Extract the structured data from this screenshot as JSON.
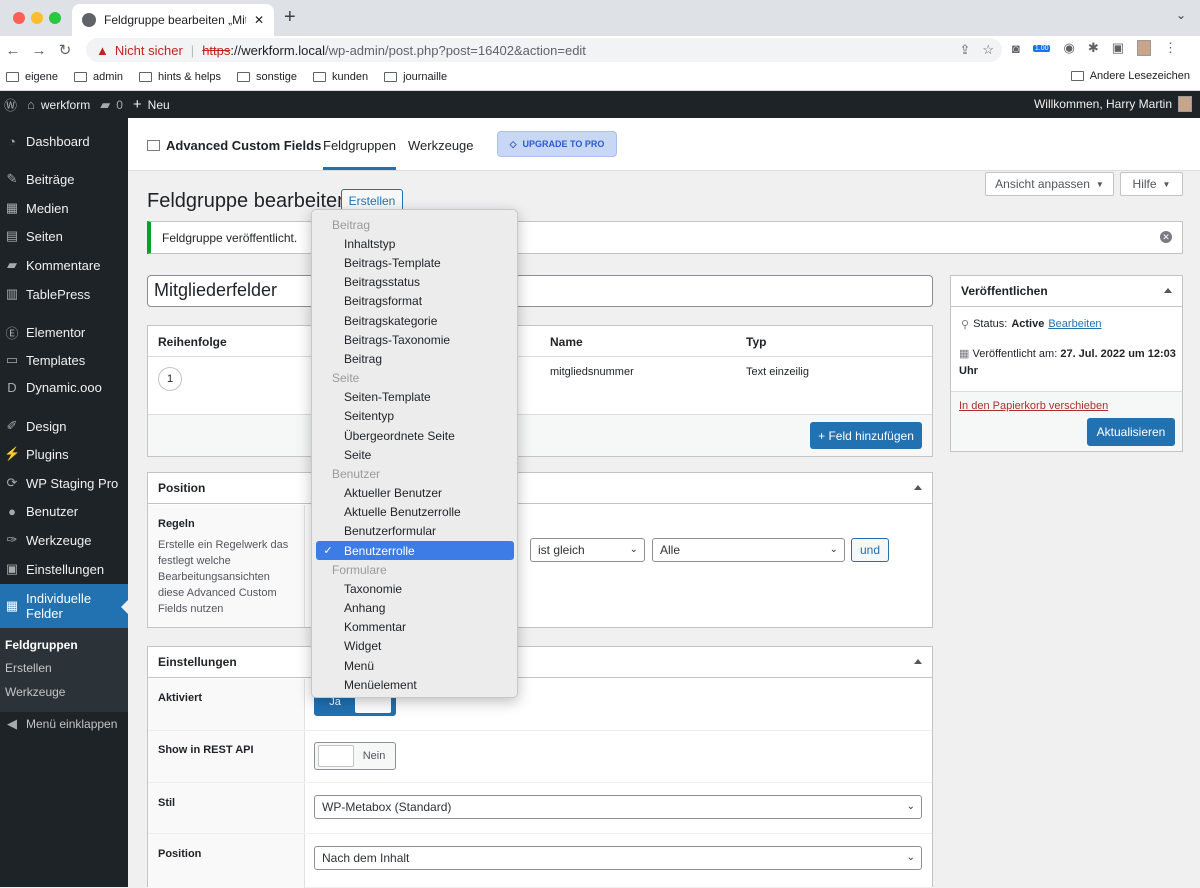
{
  "browser": {
    "tab_title": "Feldgruppe bearbeiten „Mitglie…",
    "security_text": "Nicht sicher",
    "url_scheme": "https",
    "url_host": "://werkform.local",
    "url_path": "/wp-admin/post.php?post=16402&action=edit",
    "ext_badge": "1.00",
    "bookmarks": [
      "eigene",
      "admin",
      "hints & helps",
      "sonstige",
      "kunden",
      "journaille"
    ],
    "other_bookmarks": "Andere Lesezeichen"
  },
  "adminbar": {
    "site_name": "werkform",
    "comments_count": "0",
    "new_label": "Neu",
    "greeting": "Willkommen, Harry Martin"
  },
  "sidebar": {
    "items": [
      "Dashboard",
      "Beiträge",
      "Medien",
      "Seiten",
      "Kommentare",
      "TablePress",
      "Elementor",
      "Templates",
      "Dynamic.ooo",
      "Design",
      "Plugins",
      "WP Staging Pro",
      "Benutzer",
      "Werkzeuge",
      "Einstellungen"
    ],
    "active_label": "Individuelle Felder",
    "submenu": [
      "Feldgruppen",
      "Erstellen",
      "Werkzeuge"
    ],
    "collapse_label": "Menü einklappen"
  },
  "acf": {
    "logo_text": "Advanced Custom Fields",
    "tabs": [
      "Feldgruppen",
      "Werkzeuge"
    ],
    "upgrade_label": "UPGRADE TO PRO"
  },
  "screen": {
    "options_label": "Ansicht anpassen",
    "help_label": "Hilfe"
  },
  "page": {
    "title": "Feldgruppe bearbeiten",
    "add_new_label": "Erstellen",
    "notice": "Feldgruppe veröffentlicht.",
    "group_title": "Mitgliederfelder"
  },
  "fields_table": {
    "headers": [
      "Reihenfolge",
      "Name",
      "Typ"
    ],
    "row": {
      "order": "1",
      "name": "mitgliedsnummer",
      "type": "Text einzeilig"
    },
    "add_field_label": "+ Feld hinzufügen"
  },
  "location_box": {
    "title": "Position",
    "rules_label": "Regeln",
    "rules_desc": "Erstelle ein Regelwerk das festlegt welche Bearbeitungsansichten diese Advanced Custom Fields nutzen",
    "operator": "ist gleich",
    "value": "Alle",
    "and_label": "und"
  },
  "settings_box": {
    "title": "Einstellungen",
    "active_label": "Aktiviert",
    "active_value": "Ja",
    "rest_label": "Show in REST API",
    "rest_value": "Nein",
    "style_label": "Stil",
    "style_value": "WP-Metabox (Standard)",
    "position_label": "Position",
    "position_value": "Nach dem Inhalt"
  },
  "publish_box": {
    "title": "Veröffentlichen",
    "status_prefix": "Status:",
    "status_value": "Active",
    "edit_link": "Bearbeiten",
    "published_prefix": "Veröffentlicht am:",
    "published_date": "27. Jul. 2022 um",
    "published_time": "12:03 Uhr",
    "trash_link": "In den Papierkorb verschieben",
    "update_label": "Aktualisieren"
  },
  "dropdown": {
    "groups": {
      "beitrag": "Beitrag",
      "seite": "Seite",
      "benutzer": "Benutzer",
      "formulare": "Formulare"
    },
    "beitrag_options": [
      "Inhaltstyp",
      "Beitrags-Template",
      "Beitragsstatus",
      "Beitragsformat",
      "Beitragskategorie",
      "Beitrags-Taxonomie",
      "Beitrag"
    ],
    "seite_options": [
      "Seiten-Template",
      "Seitentyp",
      "Übergeordnete Seite",
      "Seite"
    ],
    "benutzer_options": [
      "Aktueller Benutzer",
      "Aktuelle Benutzerrolle",
      "Benutzerformular"
    ],
    "selected_option": "Benutzerrolle",
    "formulare_options": [
      "Taxonomie",
      "Anhang",
      "Kommentar",
      "Widget",
      "Menü",
      "Menüelement"
    ]
  }
}
